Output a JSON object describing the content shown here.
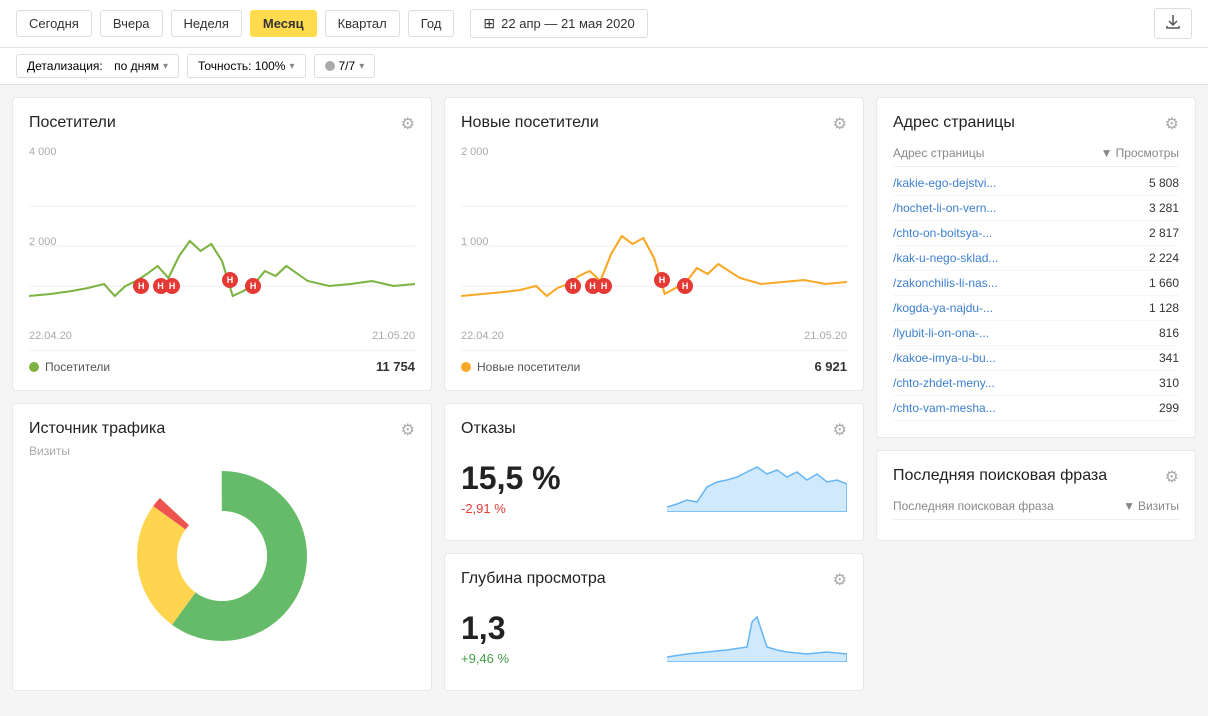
{
  "header": {
    "periods": [
      "Сегодня",
      "Вчера",
      "Неделя",
      "Месяц",
      "Квартал",
      "Год"
    ],
    "active_period": "Месяц",
    "date_range": "22 апр — 21 мая 2020",
    "detalization_label": "Детализация:",
    "detalization_value": "по дням",
    "accuracy_label": "Точность: 100%",
    "robots_label": "7/7",
    "export_title": "Экспорт"
  },
  "visitors_card": {
    "title": "Посетители",
    "y_label_top": "4 000",
    "y_label_mid": "2 000",
    "x_label_left": "22.04.20",
    "x_label_right": "21.05.20",
    "legend_label": "Посетители",
    "legend_value": "11 754",
    "color": "#7cb342"
  },
  "new_visitors_card": {
    "title": "Новые посетители",
    "y_label_top": "2 000",
    "y_label_mid": "1 000",
    "x_label_left": "22.04.20",
    "x_label_right": "21.05.20",
    "legend_label": "Новые посетители",
    "legend_value": "6 921",
    "color": "#f9a825"
  },
  "source_card": {
    "title": "Источник трафика",
    "subtitle": "Визиты"
  },
  "refusals_card": {
    "title": "Отказы",
    "value": "15,5 %",
    "change": "-2,91 %",
    "change_positive": false
  },
  "depth_card": {
    "title": "Глубина просмотра",
    "value": "1,3",
    "change": "+9,46 %",
    "change_positive": true
  },
  "page_address_card": {
    "title": "Адрес страницы",
    "col1": "Адрес страницы",
    "col2": "Просмотры",
    "rows": [
      {
        "url": "/kakie-ego-dejstvi...",
        "value": "5 808"
      },
      {
        "url": "/hochet-li-on-vern...",
        "value": "3 281"
      },
      {
        "url": "/chto-on-boitsya-...",
        "value": "2 817"
      },
      {
        "url": "/kak-u-nego-sklad...",
        "value": "2 224"
      },
      {
        "url": "/zakonchilis-li-nas...",
        "value": "1 660"
      },
      {
        "url": "/kogda-ya-najdu-...",
        "value": "1 128"
      },
      {
        "url": "/lyubit-li-on-ona-...",
        "value": "816"
      },
      {
        "url": "/kakoe-imya-u-bu...",
        "value": "341"
      },
      {
        "url": "/chto-zhdet-meny...",
        "value": "310"
      },
      {
        "url": "/chto-vam-mesha...",
        "value": "299"
      }
    ]
  },
  "search_phrase_card": {
    "title": "Последняя поисковая фраза",
    "col1": "Последняя поисковая фраза",
    "col2": "Визиты"
  },
  "colors": {
    "accent_yellow": "#ffdb4d",
    "green_chart": "#7cb342",
    "yellow_chart": "#f9a825",
    "blue_link": "#3d7fcf",
    "red_marker": "#e53935",
    "donut_green": "#66bb6a",
    "donut_yellow": "#ffd54f",
    "donut_red": "#ef5350"
  }
}
